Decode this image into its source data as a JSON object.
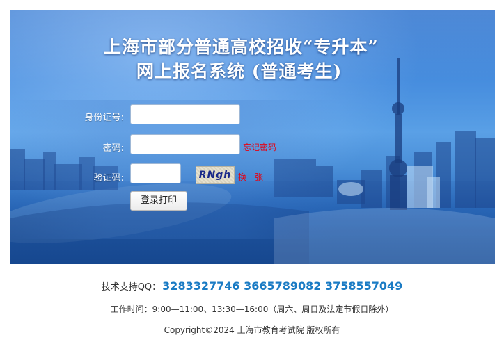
{
  "header": {
    "title_line1": "上海市部分普通高校招收“专升本”",
    "title_line2": "网上报名系统 (普通考生)"
  },
  "form": {
    "id_label": "身份证号:",
    "id_value": "",
    "password_label": "密码:",
    "password_value": "",
    "forgot_password": "忘记密码",
    "captcha_label": "验证码:",
    "captcha_value": "",
    "captcha_image_text": "RNgh",
    "refresh_captcha": "换一张",
    "submit_label": "登录打印"
  },
  "footer": {
    "support_label": "技术支持QQ：",
    "support_qq": "3283327746 3665789082 3758557049",
    "hours": "工作时间：9:00—11:00、13:30—16:00（周六、周日及法定节假日除外）",
    "copyright": "Copyright©2024 上海市教育考试院 版权所有"
  },
  "colors": {
    "accent_red": "#e60012",
    "qq_blue": "#1a7bc4",
    "banner_blue": "#3b86dc"
  }
}
